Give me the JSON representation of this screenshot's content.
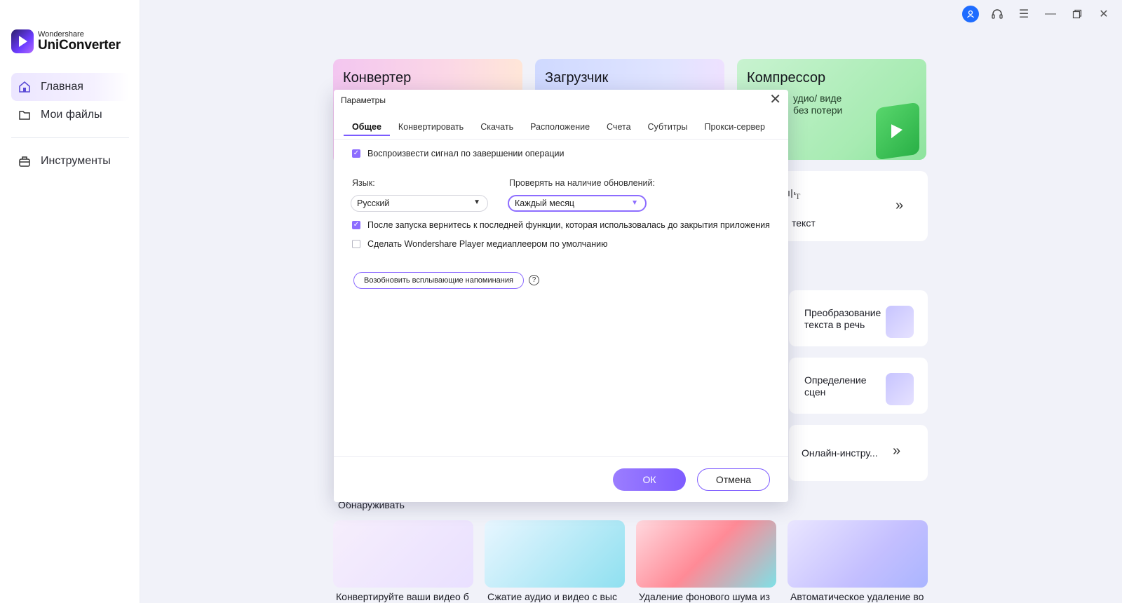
{
  "app": {
    "brand_top": "Wondershare",
    "brand_name": "UniConverter"
  },
  "sidebar": {
    "items": [
      {
        "label": "Главная",
        "icon": "home-icon",
        "active": true
      },
      {
        "label": "Мои файлы",
        "icon": "folder-icon",
        "active": false
      },
      {
        "label": "Инструменты",
        "icon": "toolbox-icon",
        "active": false
      }
    ]
  },
  "window_controls": [
    "user-avatar-icon",
    "headset-icon",
    "menu-icon",
    "minimize-icon",
    "restore-icon",
    "close-icon"
  ],
  "main": {
    "cards": {
      "converter": "Конвертер",
      "downloader": "Загрузчик",
      "compressor": "Компрессор",
      "compressor_sub_1": "удио/ виде",
      "compressor_sub_2": "без потери",
      "speech_text": "текст",
      "tts": "Преобразование текста в речь",
      "scene": "Определение сцен",
      "online": "Онлайн-инстру..."
    },
    "discover": {
      "title": "Обнаруживать",
      "items": [
        "Конвертируйте ваши видео б",
        "Сжатие аудио и видео с выс",
        "Удаление фонового шума из",
        "Автоматическое удаление во"
      ]
    }
  },
  "dialog": {
    "title": "Параметры",
    "tabs": [
      "Общее",
      "Конвертировать",
      "Скачать",
      "Расположение",
      "Счета",
      "Субтитры",
      "Прокси-сервер"
    ],
    "active_tab": "Общее",
    "play_sound_label": "Воспроизвести сигнал по завершении операции",
    "play_sound_checked": true,
    "language_label": "Язык:",
    "language_value": "Русский",
    "updates_label": "Проверять на наличие обновлений:",
    "updates_value": "Каждый месяц",
    "return_last_label": "После запуска вернитесь к последней функции, которая использовалась до закрытия приложения",
    "return_last_checked": true,
    "default_player_label": "Сделать Wondershare Player медиаплеером по умолчанию",
    "default_player_checked": false,
    "resume_reminders_label": "Возобновить всплывающие напоминания",
    "help_glyph": "?",
    "ok_label": "ОК",
    "cancel_label": "Отмена"
  },
  "colors": {
    "accent": "#8d6dff",
    "user_avatar": "#1e6cff"
  }
}
